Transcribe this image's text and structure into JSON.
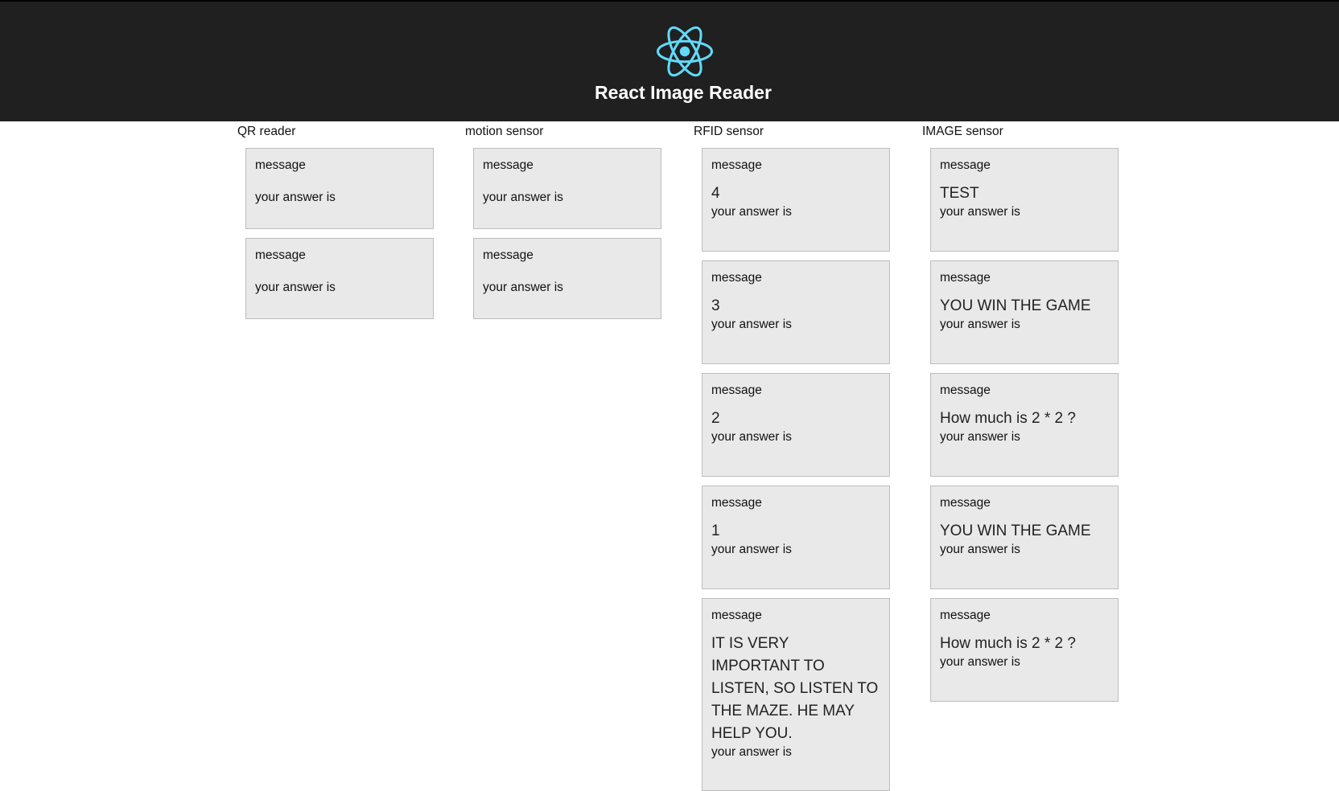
{
  "header": {
    "title": "React Image Reader",
    "logo_icon": "react-atom-icon",
    "background": "#202020",
    "logo_color": "#61dafb"
  },
  "labels": {
    "message": "message",
    "answer": "your answer is"
  },
  "columns": [
    {
      "title": "QR reader",
      "cards": [
        {
          "message": ""
        },
        {
          "message": ""
        }
      ]
    },
    {
      "title": "motion sensor",
      "cards": [
        {
          "message": ""
        },
        {
          "message": ""
        }
      ]
    },
    {
      "title": "RFID sensor",
      "cards": [
        {
          "message": "4"
        },
        {
          "message": "3"
        },
        {
          "message": "2"
        },
        {
          "message": "1"
        },
        {
          "message": "IT IS VERY IMPORTANT TO LISTEN, SO LISTEN TO THE MAZE. HE MAY HELP YOU."
        }
      ]
    },
    {
      "title": "IMAGE sensor",
      "cards": [
        {
          "message": "TEST"
        },
        {
          "message": "YOU WIN THE GAME"
        },
        {
          "message": "How much is 2 * 2 ?"
        },
        {
          "message": "YOU WIN THE GAME"
        },
        {
          "message": "How much is 2 * 2 ?"
        }
      ]
    }
  ]
}
